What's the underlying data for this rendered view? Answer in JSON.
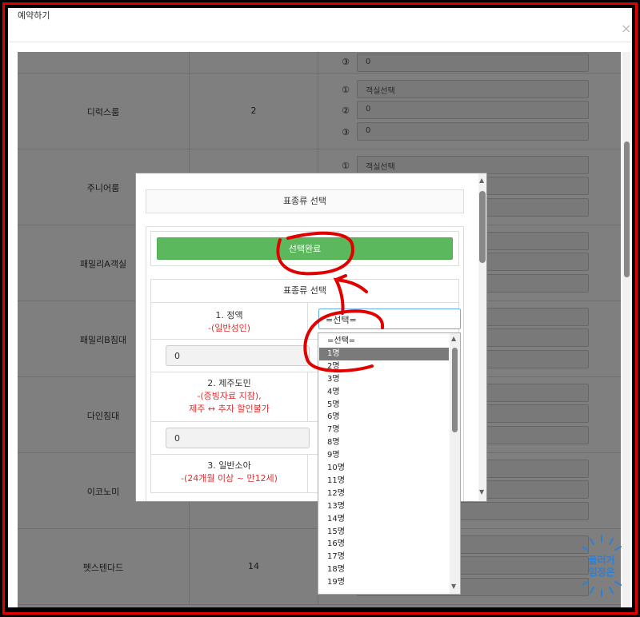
{
  "window": {
    "title": "예약하기",
    "close_glyph": "×"
  },
  "background_rows": [
    {
      "name": "",
      "count": "",
      "selects": [
        {
          "num": "③",
          "value": "0"
        }
      ]
    },
    {
      "name": "디럭스룸",
      "count": "2",
      "selects": [
        {
          "num": "①",
          "value": "객실선택"
        },
        {
          "num": "②",
          "value": "0"
        },
        {
          "num": "③",
          "value": "0"
        }
      ]
    },
    {
      "name": "주니어룸",
      "count": "",
      "selects": [
        {
          "num": "①",
          "value": "객실선택"
        }
      ]
    },
    {
      "name": "패밀리A객실",
      "count": "",
      "selects": []
    },
    {
      "name": "패밀리B침대",
      "count": "",
      "selects": []
    },
    {
      "name": "다인침대",
      "count": "",
      "selects": []
    },
    {
      "name": "이코노미",
      "count": "",
      "selects": []
    },
    {
      "name": "펫스텐다드",
      "count": "14",
      "selects": []
    }
  ],
  "modal": {
    "title": "표종류 선택",
    "done_button": "선택완료",
    "ticket_header": "표종류 선택",
    "adult": {
      "label": "1. 정액",
      "sub": "-(일반성인)",
      "value": "0",
      "select_value": "=선택="
    },
    "resident": {
      "label": "2. 제주도민",
      "sub1": "-(증빙자료 지참),",
      "sub2": "제주 ↔ 추자 할인불가",
      "value": "0"
    },
    "child": {
      "label": "3. 일반소아",
      "sub": "-(24개월 이상 ~ 만12세)"
    }
  },
  "dropdown": {
    "options": [
      "=선택=",
      "1명",
      "2명",
      "3명",
      "4명",
      "5명",
      "6명",
      "7명",
      "8명",
      "9명",
      "10명",
      "11명",
      "12명",
      "13명",
      "14명",
      "15명",
      "16명",
      "17명",
      "18명",
      "19명"
    ],
    "selected_index": 1
  },
  "watermark": {
    "line1": "플러거",
    "line2": "임정은"
  },
  "colors": {
    "accent_green": "#5cb85c",
    "annotation_red": "#e00000",
    "watermark_blue": "#2f7fd0"
  }
}
